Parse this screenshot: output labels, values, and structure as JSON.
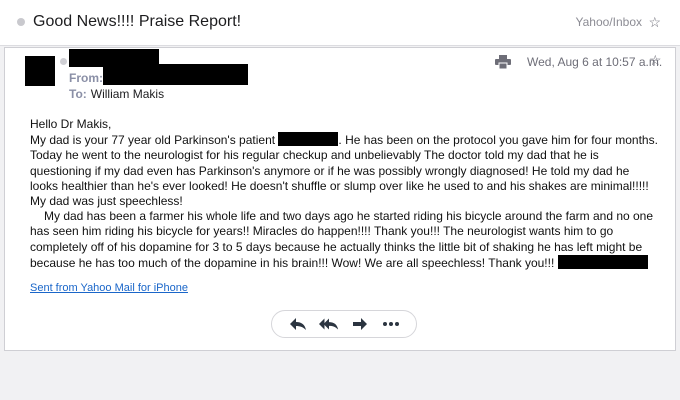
{
  "thread": {
    "subject": "Good News!!!! Praise Report!",
    "folder": "Yahoo/Inbox"
  },
  "message": {
    "from_label": "From:",
    "to_label": "To:",
    "to_name": "William Makis",
    "date": "Wed, Aug 6 at 10:57 a.m.",
    "body": {
      "greeting": "Hello Dr Makis,",
      "p1_part1": "My dad is your 77 year old Parkinson's patient ",
      "p1_part2": ". He has been on the protocol you gave him for four months. Today he went to the neurologist for his regular checkup and unbelievably The doctor told my dad that he is questioning if my dad even has Parkinson's anymore or if he was possibly wrongly diagnosed! He told my dad he looks healthier than he's ever looked! He doesn't shuffle or slump over like he used to and his shakes are minimal!!!!! My dad was just speechless!",
      "p2": "My dad has been a farmer his whole life and two days ago he started riding his bicycle around the farm and no one has seen him riding his bicycle for years!! Miracles do happen!!!! Thank you!!! The neurologist wants him to go completely off of his dopamine for 3 to 5 days because he actually thinks the little bit of shaking he has left might be because he has too much of the dopamine in his brain!!! Wow! We are all speechless! Thank you!!! "
    },
    "signature": "Sent from Yahoo Mail for iPhone"
  },
  "icons": {
    "star": "star-icon",
    "print": "print-icon",
    "reply": "reply-icon",
    "reply_all": "reply-all-icon",
    "forward": "forward-icon",
    "more": "more-icon"
  },
  "colors": {
    "link": "#1a66c9",
    "label": "#8a8fa6",
    "icon": "#2b3440"
  }
}
